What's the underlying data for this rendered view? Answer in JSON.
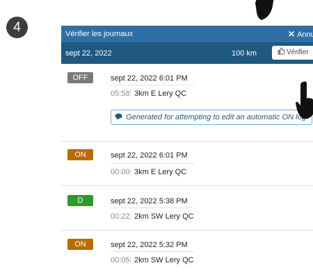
{
  "step_number": "4",
  "dialog": {
    "title": "Vérifier les journaux",
    "close_label": "Annu",
    "close_glyph": "✕",
    "date": "sept 22, 2022",
    "distance": "100 km",
    "verify_label": "Vérifier",
    "verify_icon": "thumbs-up-icon"
  },
  "log_entries": [
    {
      "status": "OFF",
      "status_color": "#7a7a7a",
      "timestamp": "sept 22, 2022 6:01 PM",
      "duration": "05:58",
      "location": "3km E Lery QC",
      "note": "Generated for attempting to edit an automatic ON log"
    },
    {
      "status": "ON",
      "status_color": "#b76b00",
      "timestamp": "sept 22, 2022 6:01 PM",
      "duration": "00:00",
      "location": "3km E Lery QC"
    },
    {
      "status": "D",
      "status_color": "#2e9a2e",
      "timestamp": "sept 22, 2022 5:38 PM",
      "duration": "00:22",
      "location": "2km SW Lery QC"
    },
    {
      "status": "ON",
      "status_color": "#b76b00",
      "timestamp": "sept 22, 2022 5:32 PM",
      "duration": "00:05",
      "location": "2km SW Lery QC"
    }
  ]
}
